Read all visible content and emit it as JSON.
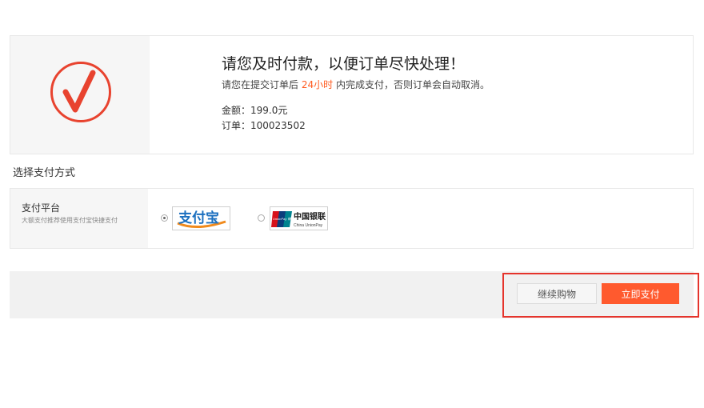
{
  "order": {
    "title": "请您及时付款，以便订单尽快处理！",
    "tip_prefix": "请您在提交订单后",
    "tip_highlight": "24小时",
    "tip_suffix": "内完成支付，否则订单会自动取消。",
    "amount": "金额：199.0元",
    "order_number": "订单：100023502",
    "icon": "checkmark-circle-icon",
    "accent_color": "#e8432f"
  },
  "payment": {
    "section_title": "选择支付方式",
    "platform_label": "支付平台",
    "platform_desc": "大额支付推荐使用支付宝快捷支付",
    "options": [
      {
        "name": "支付宝",
        "selected": true
      },
      {
        "name": "中国银联",
        "latin": "China UnionPay",
        "badge": "UnionPay 银联",
        "selected": false
      }
    ]
  },
  "actions": {
    "continue_label": "继续购物",
    "pay_label": "立即支付",
    "pay_color": "#ff5a2e"
  }
}
